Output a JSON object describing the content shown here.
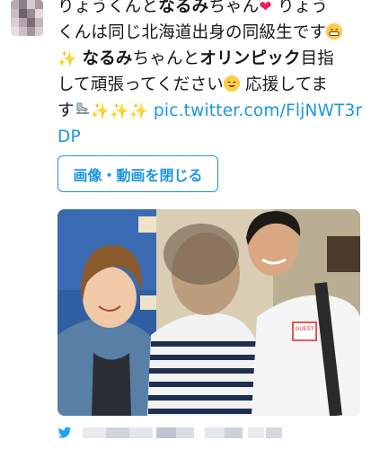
{
  "tweet": {
    "line1_a": "りょうくんと",
    "line1_b": "なるみ",
    "line1_c": "ちゃん",
    "line1_d": " りょう",
    "line2": "くんは同じ北海道出身の同級生です",
    "line3_a": " ",
    "line3_b": "なるみ",
    "line3_c": "ちゃんと",
    "line3_d": "オリンピック",
    "line3_e": "目指",
    "line4": "して頑張ってください",
    "line4_b": " 応援してま",
    "line5": "す",
    "link_part1": "pic.twitter.com/FljNWT3r",
    "link_part2": "DP"
  },
  "media": {
    "collapse_label": "画像・動画を閉じる",
    "badge_text": "GUEST"
  },
  "icons": {
    "heart": "heart-emoji-icon",
    "grin": "grinning-face-emoji-icon",
    "sparkles": "sparkles-emoji-icon",
    "skate": "ice-skate-emoji-icon",
    "bird": "twitter-bird-icon"
  },
  "colors": {
    "link": "#1b95e0",
    "text": "#14171a",
    "heart": "#e0245e"
  }
}
